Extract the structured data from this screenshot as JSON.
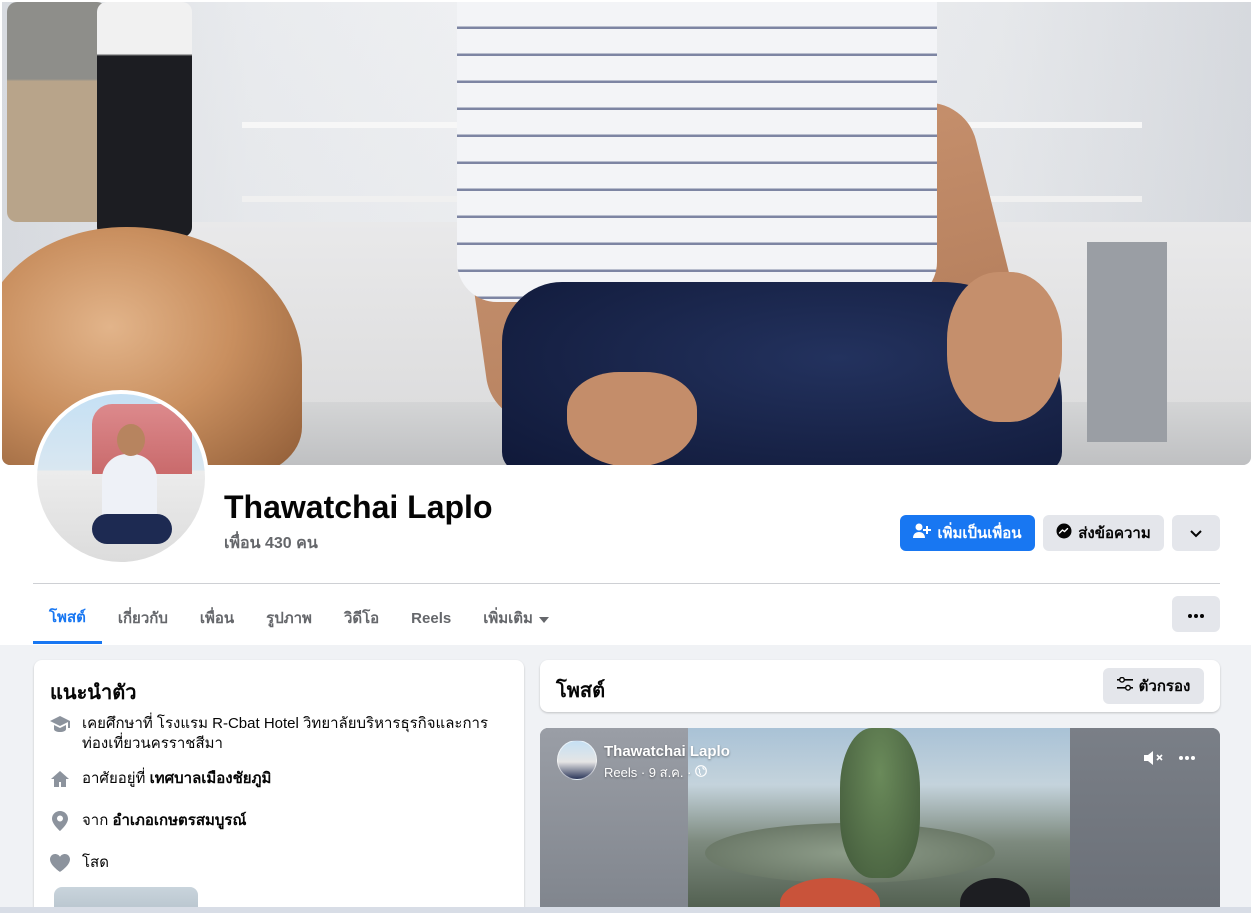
{
  "profile": {
    "name": "Thawatchai Laplo",
    "friends_count": "เพื่อน 430 คน"
  },
  "actions": {
    "add_friend": "เพิ่มเป็นเพื่อน",
    "message": "ส่งข้อความ"
  },
  "tabs": [
    {
      "label": "โพสต์",
      "active": true
    },
    {
      "label": "เกี่ยวกับ",
      "active": false
    },
    {
      "label": "เพื่อน",
      "active": false
    },
    {
      "label": "รูปภาพ",
      "active": false
    },
    {
      "label": "วิดีโอ",
      "active": false
    },
    {
      "label": "Reels",
      "active": false
    },
    {
      "label": "เพิ่มเติม",
      "active": false
    }
  ],
  "intro": {
    "title": "แนะนำตัว",
    "education_prefix": "เคยศึกษาที่ ",
    "education": "โรงแรม R-Cbat Hotel วิทยาลัยบริหารธุรกิจและการท่องเที่ยวนครราชสีมา",
    "lives_prefix": "อาศัยอยู่ที่ ",
    "lives": "เทศบาลเมืองชัยภูมิ",
    "from_prefix": "จาก ",
    "from": "อำเภอเกษตรสมบูรณ์",
    "relationship": "โสด"
  },
  "posts": {
    "title": "โพสต์",
    "filter": "ตัวกรอง"
  },
  "reel_post": {
    "author": "Thawatchai Laplo",
    "meta": "Reels · 9 ส.ค. ·"
  },
  "colors": {
    "accent": "#1877f2",
    "button_secondary": "#e4e6eb",
    "page_bg": "#f0f2f5",
    "text_secondary": "#65676b"
  }
}
